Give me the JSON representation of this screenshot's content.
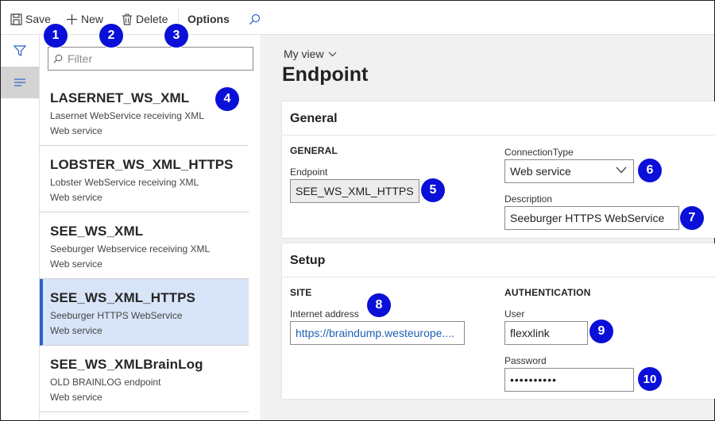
{
  "toolbar": {
    "save_label": "Save",
    "new_label": "New",
    "delete_label": "Delete",
    "options_label": "Options"
  },
  "filter": {
    "placeholder": "Filter"
  },
  "list": [
    {
      "title": "LASERNET_WS_XML",
      "description": "Lasernet WebService receiving XML",
      "type": "Web service"
    },
    {
      "title": "LOBSTER_WS_XML_HTTPS",
      "description": "Lobster WebService receiving XML",
      "type": "Web service"
    },
    {
      "title": "SEE_WS_XML",
      "description": "Seeburger Webservice receiving XML",
      "type": "Web service"
    },
    {
      "title": "SEE_WS_XML_HTTPS",
      "description": "Seeburger HTTPS WebService",
      "type": "Web service",
      "selected": true
    },
    {
      "title": "SEE_WS_XMLBrainLog",
      "description": "OLD BRAINLOG endpoint",
      "type": "Web service"
    }
  ],
  "main": {
    "view_label": "My view",
    "page_title": "Endpoint",
    "general": {
      "header": "General",
      "group_label": "GENERAL",
      "endpoint_label": "Endpoint",
      "endpoint_value": "SEE_WS_XML_HTTPS",
      "connection_type_label": "ConnectionType",
      "connection_type_value": "Web service",
      "description_label": "Description",
      "description_value": "Seeburger HTTPS WebService"
    },
    "setup": {
      "header": "Setup",
      "site_group": "SITE",
      "internet_address_label": "Internet address",
      "internet_address_value": "https://braindump.westeurope....",
      "auth_group": "AUTHENTICATION",
      "user_label": "User",
      "user_value": "flexxlink",
      "password_label": "Password",
      "password_value": "••••••••••"
    }
  },
  "badges": [
    "1",
    "2",
    "3",
    "4",
    "5",
    "6",
    "7",
    "8",
    "9",
    "10"
  ],
  "colors": {
    "accent": "#2c62c8",
    "badge": "#0a10d8",
    "selected_bg": "#d8e4f8"
  }
}
